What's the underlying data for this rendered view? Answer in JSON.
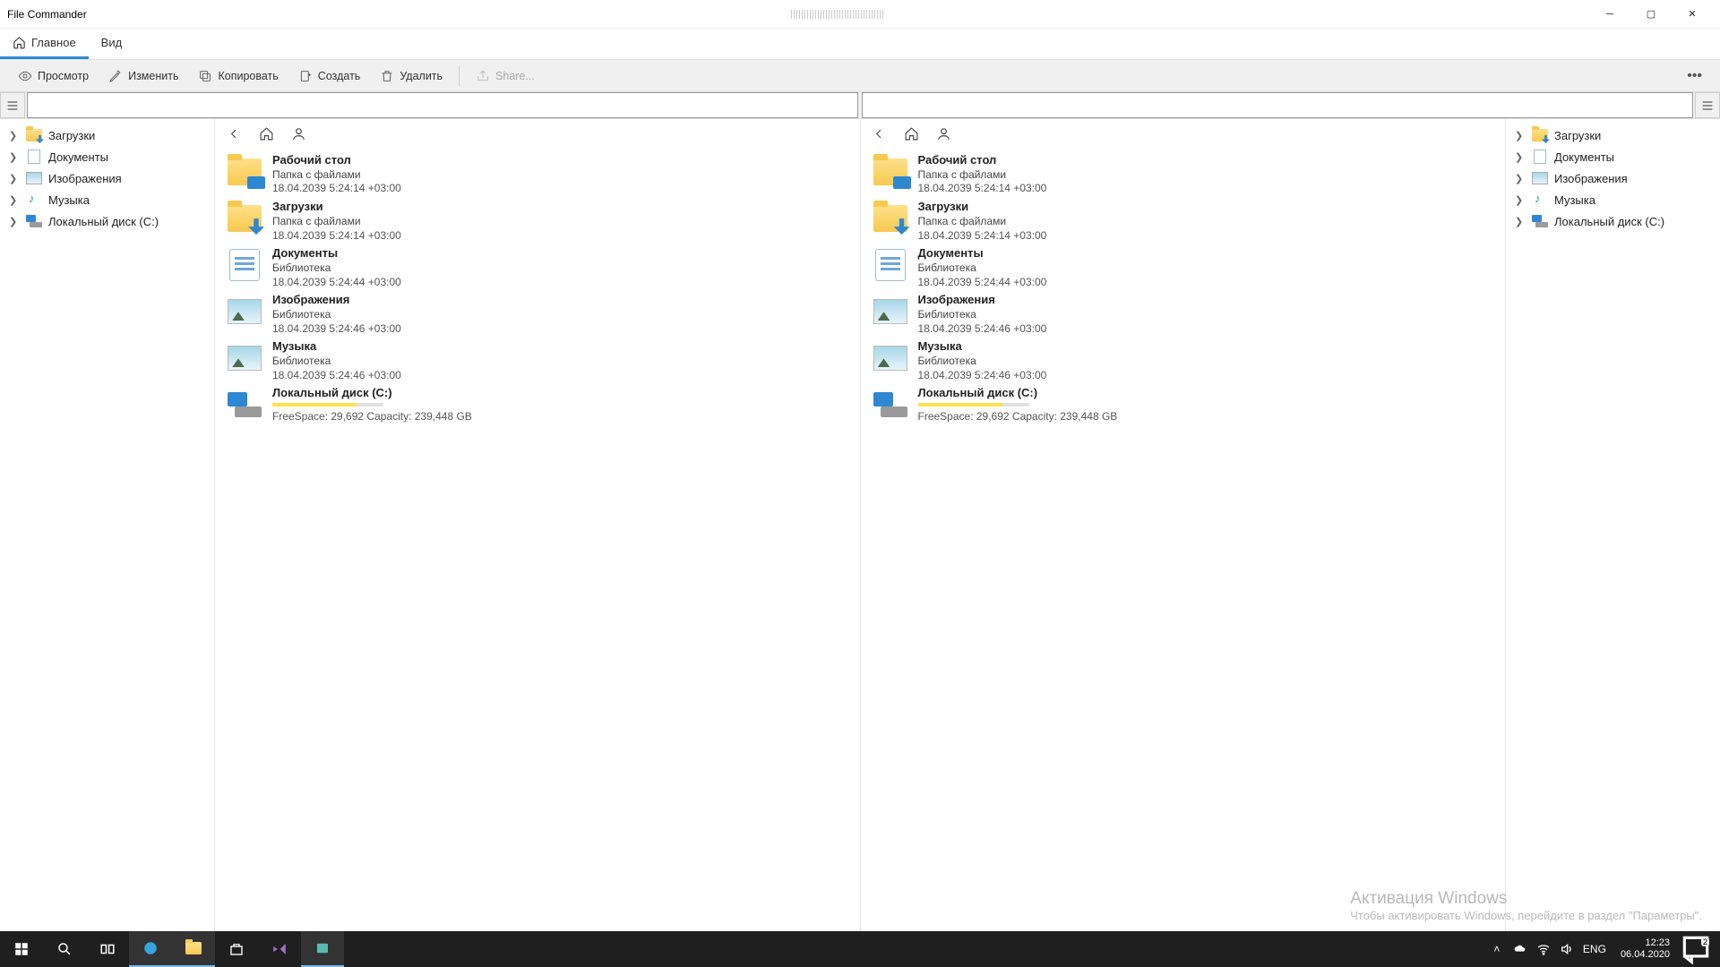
{
  "window": {
    "title": "File Commander"
  },
  "tabs": {
    "main": "Главное",
    "view": "Вид"
  },
  "toolbar": {
    "view": "Просмотр",
    "edit": "Изменить",
    "copy": "Копировать",
    "create": "Создать",
    "delete": "Удалить",
    "share": "Share..."
  },
  "tree": {
    "items": [
      {
        "label": "Загрузки",
        "icon": "folder-dl"
      },
      {
        "label": "Документы",
        "icon": "doc"
      },
      {
        "label": "Изображения",
        "icon": "pic"
      },
      {
        "label": "Музыка",
        "icon": "music"
      },
      {
        "label": "Локальный диск (C:)",
        "icon": "disk"
      }
    ]
  },
  "pane": {
    "items": [
      {
        "name": "Рабочий стол",
        "sub": "Папка с файлами",
        "date": "18.04.2039 5:24:14 +03:00",
        "icon": "desktop"
      },
      {
        "name": "Загрузки",
        "sub": "Папка с файлами",
        "date": "18.04.2039 5:24:14 +03:00",
        "icon": "downloads"
      },
      {
        "name": "Документы",
        "sub": "Библиотека",
        "date": "18.04.2039 5:24:44 +03:00",
        "icon": "documents"
      },
      {
        "name": "Изображения",
        "sub": "Библиотека",
        "date": "18.04.2039 5:24:46 +03:00",
        "icon": "pictures"
      },
      {
        "name": "Музыка",
        "sub": "Библиотека",
        "date": "18.04.2039 5:24:46 +03:00",
        "icon": "pictures"
      },
      {
        "name": "Локальный диск (C:)",
        "sub": "",
        "date": "",
        "icon": "disk",
        "disk": {
          "free_label": "FreeSpace:",
          "free": "29,692",
          "cap_label": "Capacity:",
          "cap": "239,448 GB"
        }
      }
    ]
  },
  "watermark": {
    "title": "Активация Windows",
    "sub": "Чтобы активировать Windows, перейдите в раздел \"Параметры\"."
  },
  "tray": {
    "lang": "ENG",
    "time": "12:23",
    "date": "06.04.2020",
    "notif": "2"
  }
}
